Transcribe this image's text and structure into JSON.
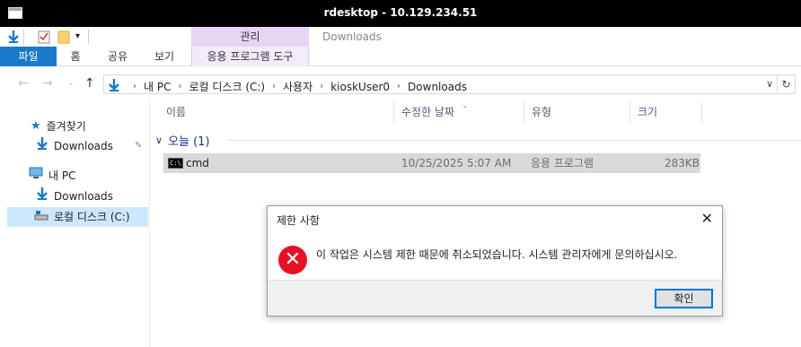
{
  "window": {
    "title": "rdesktop - 10.129.234.51"
  },
  "ribbon": {
    "context_header": "관리",
    "context_title": "Downloads",
    "tabs": [
      "파일",
      "홈",
      "공유",
      "보기"
    ],
    "context_tab": "응용 프로그램 도구"
  },
  "address": {
    "crumbs": [
      "내 PC",
      "로컬 디스크 (C:)",
      "사용자",
      "kioskUser0",
      "Downloads"
    ]
  },
  "nav": {
    "quick_access": "즐겨찾기",
    "quick_downloads": "Downloads",
    "this_pc": "내 PC",
    "pc_downloads": "Downloads",
    "local_disk": "로컬 디스크 (C:)"
  },
  "list": {
    "columns": [
      "이름",
      "수정한 날짜",
      "유형",
      "크기"
    ],
    "group": "오늘 (1)",
    "files": [
      {
        "name": "cmd",
        "modified": "10/25/2025 5:07 AM",
        "type": "응용 프로그램",
        "size": "283KB"
      }
    ]
  },
  "dialog": {
    "title": "제한 사항",
    "message": "이 작업은 시스템 제한 때문에 취소되었습니다. 시스템 관리자에게 문의하십시오.",
    "ok_label": "확인"
  },
  "icon_names": [
    "app-icon",
    "down-arrow-icon",
    "checkbox-icon",
    "folder-icon",
    "pin-icon",
    "star-icon",
    "pc-icon",
    "drive-icon",
    "cmd-icon",
    "error-icon",
    "close-icon",
    "refresh-icon"
  ]
}
